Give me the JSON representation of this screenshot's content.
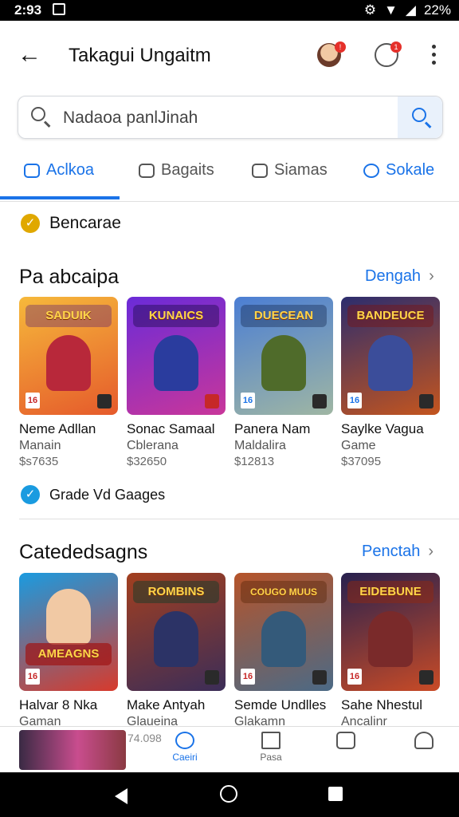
{
  "status_bar": {
    "time": "2:93",
    "battery": "22%"
  },
  "app_bar": {
    "title": "Takagui Ungaitm"
  },
  "search": {
    "value": "Nadaoa panlJinah"
  },
  "tabs": [
    {
      "label": "Aclkoa"
    },
    {
      "label": "Bagaits"
    },
    {
      "label": "Siamas"
    },
    {
      "label": "Sokale"
    }
  ],
  "banner_row": {
    "label": "Bencarae",
    "accent": "#e0a800"
  },
  "section1": {
    "title": "Pa abcaipa",
    "more_label": "Dengah",
    "cards": [
      {
        "name": "Neme Adllan",
        "sub": "Manain",
        "price": "$s7635",
        "logo": "SADUIK",
        "rating": "16",
        "colors": [
          "#f6b93b",
          "#e55a2b"
        ]
      },
      {
        "name": "Sonac Samaal",
        "sub": "Cblerana",
        "price": "$32650",
        "logo": "KUNAICS",
        "rating": "",
        "colors": [
          "#6a2bd8",
          "#c9369a"
        ]
      },
      {
        "name": "Panera Nam",
        "sub": "Maldalira",
        "price": "$12813",
        "logo": "DUECEAN",
        "rating": "16",
        "colors": [
          "#4b7ed4",
          "#9fb6a3"
        ]
      },
      {
        "name": "Saylke Vagua",
        "sub": "Game",
        "price": "$37095",
        "logo": "BANDEUCE",
        "rating": "16",
        "colors": [
          "#2c2d6e",
          "#c4551e"
        ]
      }
    ]
  },
  "check_row": {
    "label": "Grade Vd Gaages",
    "accent": "#1a9be0"
  },
  "section2": {
    "title": "Catededsagns",
    "more_label": "Penctah",
    "cards": [
      {
        "name": "Halvar 8 Nka",
        "sub": "Gaman",
        "logo": "AMEAGNS",
        "rating": "16",
        "colors": [
          "#1a9be0",
          "#d83a2c"
        ]
      },
      {
        "name": "Make Antyah",
        "sub": "Glaueina",
        "logo": "ROMBINS",
        "rating": "",
        "colors": [
          "#a33f1f",
          "#3b2d58"
        ]
      },
      {
        "name": "Semde Undlles",
        "sub": "Glakamn",
        "logo": "COUGO MUUS",
        "rating": "16",
        "colors": [
          "#b6542a",
          "#4b6a86"
        ]
      },
      {
        "name": "Sahe Nhestul",
        "sub": "Ancalinr",
        "logo": "EIDEBUNE",
        "rating": "16",
        "colors": [
          "#27214f",
          "#c94b26"
        ]
      }
    ]
  },
  "bottom_nav": {
    "mini_price": "74.098",
    "items": [
      {
        "label": "Caeiri"
      },
      {
        "label": "Pasa"
      },
      {
        "label": ""
      },
      {
        "label": ""
      }
    ]
  }
}
